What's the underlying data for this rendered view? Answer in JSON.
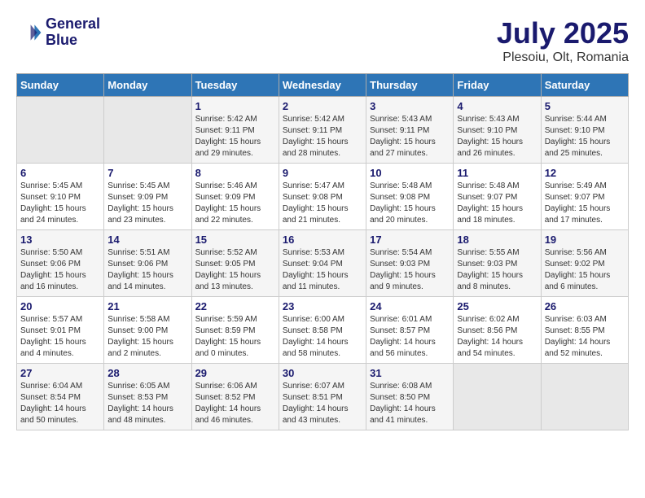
{
  "header": {
    "logo_line1": "General",
    "logo_line2": "Blue",
    "month": "July 2025",
    "location": "Plesoiu, Olt, Romania"
  },
  "weekdays": [
    "Sunday",
    "Monday",
    "Tuesday",
    "Wednesday",
    "Thursday",
    "Friday",
    "Saturday"
  ],
  "weeks": [
    [
      {
        "day": "",
        "empty": true
      },
      {
        "day": "",
        "empty": true
      },
      {
        "day": "1",
        "sunrise": "5:42 AM",
        "sunset": "9:11 PM",
        "daylight": "15 hours and 29 minutes."
      },
      {
        "day": "2",
        "sunrise": "5:42 AM",
        "sunset": "9:11 PM",
        "daylight": "15 hours and 28 minutes."
      },
      {
        "day": "3",
        "sunrise": "5:43 AM",
        "sunset": "9:11 PM",
        "daylight": "15 hours and 27 minutes."
      },
      {
        "day": "4",
        "sunrise": "5:43 AM",
        "sunset": "9:10 PM",
        "daylight": "15 hours and 26 minutes."
      },
      {
        "day": "5",
        "sunrise": "5:44 AM",
        "sunset": "9:10 PM",
        "daylight": "15 hours and 25 minutes."
      }
    ],
    [
      {
        "day": "6",
        "sunrise": "5:45 AM",
        "sunset": "9:10 PM",
        "daylight": "15 hours and 24 minutes."
      },
      {
        "day": "7",
        "sunrise": "5:45 AM",
        "sunset": "9:09 PM",
        "daylight": "15 hours and 23 minutes."
      },
      {
        "day": "8",
        "sunrise": "5:46 AM",
        "sunset": "9:09 PM",
        "daylight": "15 hours and 22 minutes."
      },
      {
        "day": "9",
        "sunrise": "5:47 AM",
        "sunset": "9:08 PM",
        "daylight": "15 hours and 21 minutes."
      },
      {
        "day": "10",
        "sunrise": "5:48 AM",
        "sunset": "9:08 PM",
        "daylight": "15 hours and 20 minutes."
      },
      {
        "day": "11",
        "sunrise": "5:48 AM",
        "sunset": "9:07 PM",
        "daylight": "15 hours and 18 minutes."
      },
      {
        "day": "12",
        "sunrise": "5:49 AM",
        "sunset": "9:07 PM",
        "daylight": "15 hours and 17 minutes."
      }
    ],
    [
      {
        "day": "13",
        "sunrise": "5:50 AM",
        "sunset": "9:06 PM",
        "daylight": "15 hours and 16 minutes."
      },
      {
        "day": "14",
        "sunrise": "5:51 AM",
        "sunset": "9:06 PM",
        "daylight": "15 hours and 14 minutes."
      },
      {
        "day": "15",
        "sunrise": "5:52 AM",
        "sunset": "9:05 PM",
        "daylight": "15 hours and 13 minutes."
      },
      {
        "day": "16",
        "sunrise": "5:53 AM",
        "sunset": "9:04 PM",
        "daylight": "15 hours and 11 minutes."
      },
      {
        "day": "17",
        "sunrise": "5:54 AM",
        "sunset": "9:03 PM",
        "daylight": "15 hours and 9 minutes."
      },
      {
        "day": "18",
        "sunrise": "5:55 AM",
        "sunset": "9:03 PM",
        "daylight": "15 hours and 8 minutes."
      },
      {
        "day": "19",
        "sunrise": "5:56 AM",
        "sunset": "9:02 PM",
        "daylight": "15 hours and 6 minutes."
      }
    ],
    [
      {
        "day": "20",
        "sunrise": "5:57 AM",
        "sunset": "9:01 PM",
        "daylight": "15 hours and 4 minutes."
      },
      {
        "day": "21",
        "sunrise": "5:58 AM",
        "sunset": "9:00 PM",
        "daylight": "15 hours and 2 minutes."
      },
      {
        "day": "22",
        "sunrise": "5:59 AM",
        "sunset": "8:59 PM",
        "daylight": "15 hours and 0 minutes."
      },
      {
        "day": "23",
        "sunrise": "6:00 AM",
        "sunset": "8:58 PM",
        "daylight": "14 hours and 58 minutes."
      },
      {
        "day": "24",
        "sunrise": "6:01 AM",
        "sunset": "8:57 PM",
        "daylight": "14 hours and 56 minutes."
      },
      {
        "day": "25",
        "sunrise": "6:02 AM",
        "sunset": "8:56 PM",
        "daylight": "14 hours and 54 minutes."
      },
      {
        "day": "26",
        "sunrise": "6:03 AM",
        "sunset": "8:55 PM",
        "daylight": "14 hours and 52 minutes."
      }
    ],
    [
      {
        "day": "27",
        "sunrise": "6:04 AM",
        "sunset": "8:54 PM",
        "daylight": "14 hours and 50 minutes."
      },
      {
        "day": "28",
        "sunrise": "6:05 AM",
        "sunset": "8:53 PM",
        "daylight": "14 hours and 48 minutes."
      },
      {
        "day": "29",
        "sunrise": "6:06 AM",
        "sunset": "8:52 PM",
        "daylight": "14 hours and 46 minutes."
      },
      {
        "day": "30",
        "sunrise": "6:07 AM",
        "sunset": "8:51 PM",
        "daylight": "14 hours and 43 minutes."
      },
      {
        "day": "31",
        "sunrise": "6:08 AM",
        "sunset": "8:50 PM",
        "daylight": "14 hours and 41 minutes."
      },
      {
        "day": "",
        "empty": true
      },
      {
        "day": "",
        "empty": true
      }
    ]
  ]
}
